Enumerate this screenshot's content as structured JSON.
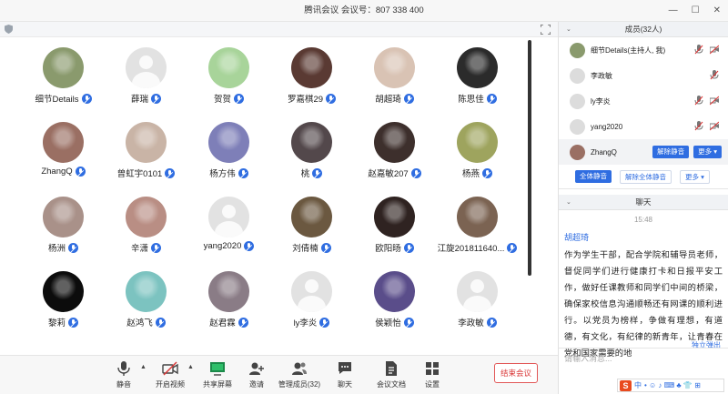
{
  "window": {
    "title": "腾讯会议  会议号：807 338 400"
  },
  "participants": [
    {
      "name": "细节Details",
      "avatar_color": "#8a9a6d",
      "avatar_kind": "photo"
    },
    {
      "name": "薛瑞",
      "avatar_color": "#e2e2e2",
      "avatar_kind": "default"
    },
    {
      "name": "贺贺",
      "avatar_color": "#a8d49a",
      "avatar_kind": "photo"
    },
    {
      "name": "罗嘉棋29",
      "avatar_color": "#5a3a33",
      "avatar_kind": "photo"
    },
    {
      "name": "胡超琦",
      "avatar_color": "#d9c3b4",
      "avatar_kind": "photo"
    },
    {
      "name": "陈思佳",
      "avatar_color": "#2b2b2b",
      "avatar_kind": "photo"
    },
    {
      "name": "ZhangQ",
      "avatar_color": "#9a6f63",
      "avatar_kind": "photo"
    },
    {
      "name": "曾虹宇0101",
      "avatar_color": "#c9b4a6",
      "avatar_kind": "photo"
    },
    {
      "name": "杨方伟",
      "avatar_color": "#7e7fb8",
      "avatar_kind": "photo"
    },
    {
      "name": "桃",
      "avatar_color": "#53484b",
      "avatar_kind": "photo"
    },
    {
      "name": "赵嘉敏207",
      "avatar_color": "#3d2f2c",
      "avatar_kind": "photo"
    },
    {
      "name": "杨燕",
      "avatar_color": "#9ea45e",
      "avatar_kind": "photo"
    },
    {
      "name": "杨洲",
      "avatar_color": "#a99189",
      "avatar_kind": "photo"
    },
    {
      "name": "辛潇",
      "avatar_color": "#b98e84",
      "avatar_kind": "photo"
    },
    {
      "name": "yang2020",
      "avatar_color": "#e2e2e2",
      "avatar_kind": "default"
    },
    {
      "name": "刘倩楠",
      "avatar_color": "#6b5840",
      "avatar_kind": "photo"
    },
    {
      "name": "欧阳旸",
      "avatar_color": "#2f2321",
      "avatar_kind": "photo"
    },
    {
      "name": "江旋201811640...",
      "avatar_color": "#7b6352",
      "avatar_kind": "photo"
    },
    {
      "name": "黎莉",
      "avatar_color": "#0c0c0c",
      "avatar_kind": "photo"
    },
    {
      "name": "赵鸿飞",
      "avatar_color": "#7cc3c0",
      "avatar_kind": "photo"
    },
    {
      "name": "赵君霖",
      "avatar_color": "#8a7c86",
      "avatar_kind": "photo"
    },
    {
      "name": "ly李炎",
      "avatar_color": "#e2e2e2",
      "avatar_kind": "default"
    },
    {
      "name": "侯颖怡",
      "avatar_color": "#5a4d8a",
      "avatar_kind": "photo"
    },
    {
      "name": "李政敏",
      "avatar_color": "#e2e2e2",
      "avatar_kind": "default"
    }
  ],
  "toolbar": {
    "mute": "静音",
    "video": "开启视频",
    "share": "共享屏幕",
    "invite": "邀请",
    "manage": "管理成员(32)",
    "chat": "聊天",
    "docs": "会议文档",
    "settings": "设置",
    "end": "结束会议"
  },
  "members_panel": {
    "title": "成员(32人)",
    "members": [
      {
        "name": "细节Details(主持人, 我)",
        "avatar_color": "#8a9a6d"
      },
      {
        "name": "李政敏",
        "avatar_color": "#dcdcdc"
      },
      {
        "name": "ly李炎",
        "avatar_color": "#dcdcdc"
      },
      {
        "name": "yang2020",
        "avatar_color": "#dcdcdc"
      }
    ],
    "selected": {
      "name": "ZhangQ",
      "avatar_color": "#9a6f63",
      "unmute": "解除静音",
      "more": "更多 ▾"
    },
    "actions": {
      "mute_all": "全体静音",
      "unmute_all": "解除全体静音",
      "more": "更多 ▾"
    }
  },
  "chat_panel": {
    "title": "聊天",
    "time": "15:48",
    "sender": "胡超琦",
    "message": "作为学生干部，配合学院和辅导员老师，督促同学们进行健康打卡和日报平安工作，做好任课教师和同学们中间的桥梁，确保家校信息沟通顺畅还有网课的顺利进行。以党员为榜样，争做有理想，有道德，有文化，有纪律的新青年，让青春在党和国家需要的地",
    "pop_out": "独立弹出",
    "input_placeholder": "请输入消息..."
  },
  "ime": {
    "logo": "S",
    "mode": "中",
    "icons": "• ☺ ♪ ⌨ ♣ 👕 ⊞"
  }
}
